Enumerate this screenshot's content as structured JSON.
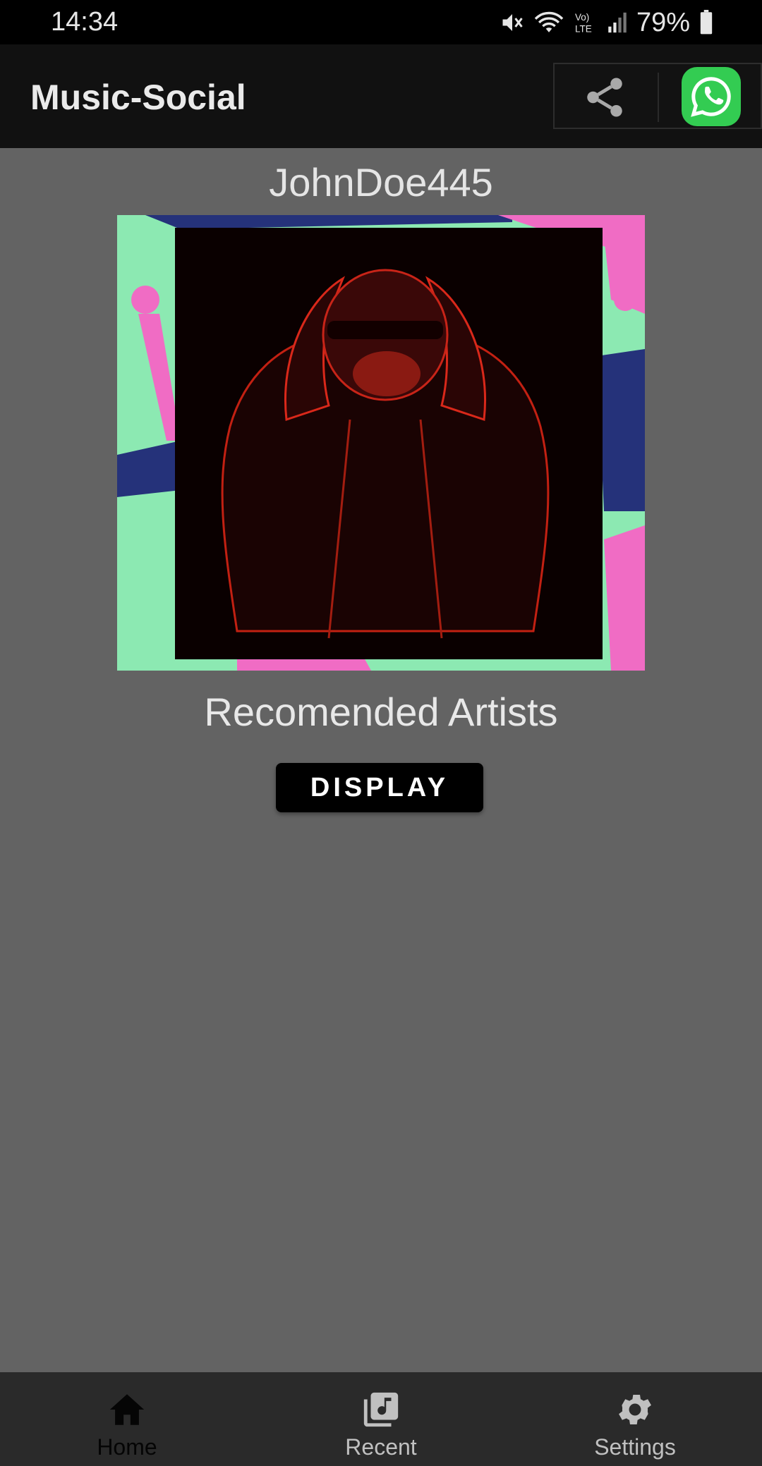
{
  "status_bar": {
    "time": "14:34",
    "battery": "79%",
    "icons": [
      "mute-icon",
      "wifi-icon",
      "volte-icon",
      "signal-icon",
      "battery-icon"
    ]
  },
  "app_bar": {
    "title": "Music-Social",
    "actions": [
      {
        "name": "share-icon"
      },
      {
        "name": "whatsapp-icon",
        "color": "#33cc52"
      }
    ]
  },
  "profile": {
    "username": "JohnDoe445",
    "image": "profile-photo"
  },
  "recommended": {
    "title": "Recomended Artists",
    "button_label": "DISPLAY"
  },
  "bottom_nav": {
    "items": [
      {
        "label": "Home",
        "icon": "home-icon",
        "active": true
      },
      {
        "label": "Recent",
        "icon": "music-library-icon",
        "active": false
      },
      {
        "label": "Settings",
        "icon": "gear-icon",
        "active": false
      }
    ]
  },
  "colors": {
    "background": "#636363",
    "app_bar": "#111111",
    "status_bar": "#000000",
    "bottom_nav": "#2a2a2a",
    "active_nav": "#050505",
    "inactive_nav": "#c0c0c0"
  }
}
